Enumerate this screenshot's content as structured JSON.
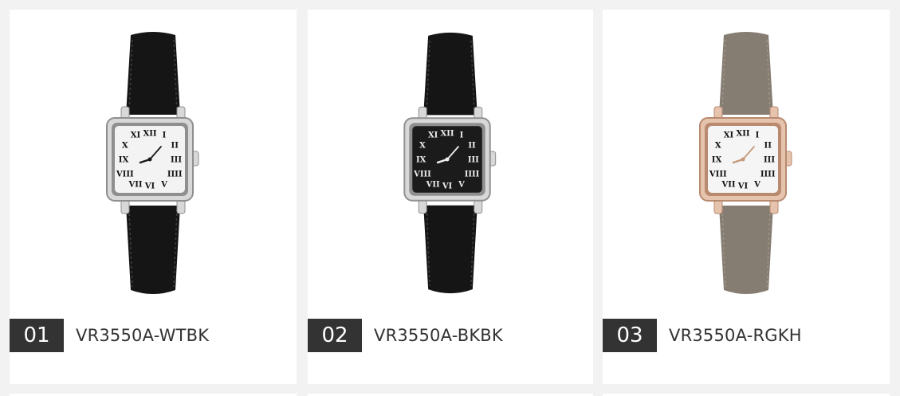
{
  "products": [
    {
      "number": "01",
      "model": "VR3550A-WTBK",
      "colors": {
        "strap": "#151515",
        "case": "#d8d8d8",
        "case_edge": "#8f8f8f",
        "dial": "#f3f3f3",
        "numeral": "#111111",
        "hands": "#1a1a1a"
      }
    },
    {
      "number": "02",
      "model": "VR3550A-BKBK",
      "colors": {
        "strap": "#151515",
        "case": "#d8d8d8",
        "case_edge": "#8f8f8f",
        "dial": "#1b1b1b",
        "numeral": "#eeeeee",
        "hands": "#eeeeee"
      }
    },
    {
      "number": "03",
      "model": "VR3550A-RGKH",
      "colors": {
        "strap": "#867d72",
        "case": "#e6c3ad",
        "case_edge": "#b88a70",
        "dial": "#f5f5f5",
        "numeral": "#111111",
        "hands": "#c59a7c"
      }
    }
  ]
}
